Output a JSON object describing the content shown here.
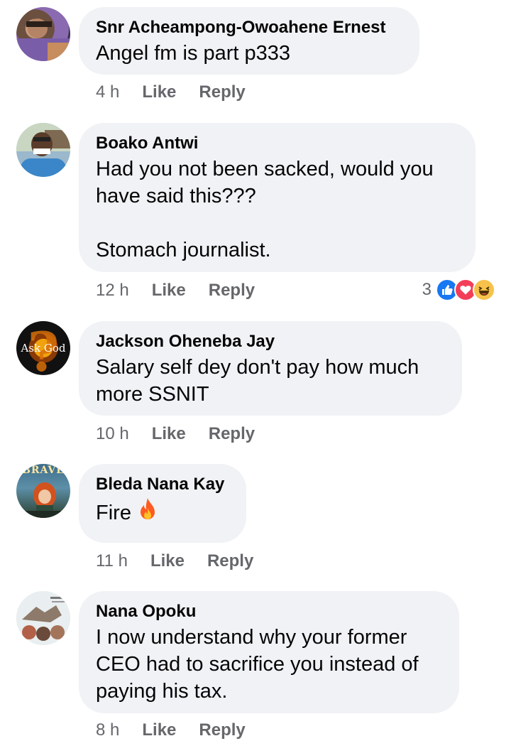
{
  "comments": [
    {
      "author": "Snr Acheampong-Owoahene Ernest",
      "text": "Angel fm is part p333",
      "time": "4 h",
      "like": "Like",
      "reply": "Reply"
    },
    {
      "author": "Boako Antwi",
      "text": "Had you not been sacked, would you\nhave said this???\n\nStomach journalist.",
      "time": "12 h",
      "like": "Like",
      "reply": "Reply",
      "reaction_count": "3",
      "reaction_icons": [
        "like-icon",
        "love-icon",
        "haha-icon"
      ]
    },
    {
      "author": "Jackson Oheneba Jay",
      "text": "Salary self dey don't pay how much\nmore SSNIT",
      "time": "10 h",
      "like": "Like",
      "reply": "Reply",
      "avatar_text": "Ask God"
    },
    {
      "author": "Bleda Nana Kay",
      "text": "Fire",
      "time": "11 h",
      "like": "Like",
      "reply": "Reply",
      "avatar_text": "BRAVE",
      "emoji": "fire-icon"
    },
    {
      "author": "Nana Opoku",
      "text": "I now understand why your former\nCEO had to sacrifice you instead of\npaying his tax.",
      "time": "8 h",
      "like": "Like",
      "reply": "Reply"
    }
  ],
  "colors": {
    "bubble": "#f0f2f5",
    "meta_text": "#65676b",
    "like_blue": "#1877f2",
    "love_red": "#f33e58",
    "haha_yellow": "#f7c24b"
  }
}
